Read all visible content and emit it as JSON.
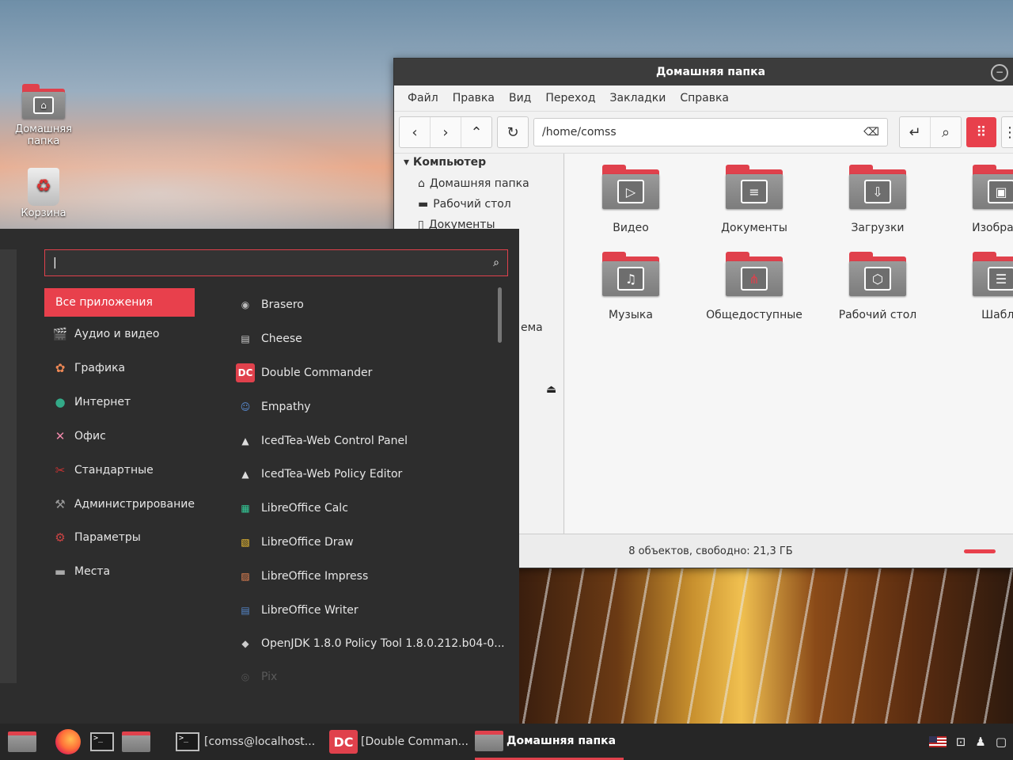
{
  "desktop": {
    "icons": [
      {
        "label": "Домашняя папка",
        "icon": "home-folder-icon"
      },
      {
        "label": "Корзина",
        "icon": "trash-icon"
      }
    ]
  },
  "file_manager": {
    "title": "Домашняя папка",
    "menu": [
      "Файл",
      "Правка",
      "Вид",
      "Переход",
      "Закладки",
      "Справка"
    ],
    "path": "/home/comss",
    "sidebar": {
      "heading": "Компьютер",
      "items": [
        "Домашняя папка",
        "Рабочий стол",
        "Документы"
      ],
      "partial_text": "ема"
    },
    "folders": [
      {
        "label": "Видео",
        "icon": "video-icon"
      },
      {
        "label": "Документы",
        "icon": "document-icon"
      },
      {
        "label": "Загрузки",
        "icon": "download-icon"
      },
      {
        "label": "Изображе",
        "icon": "image-icon"
      },
      {
        "label": "Музыка",
        "icon": "music-icon"
      },
      {
        "label": "Общедоступные",
        "icon": "share-icon"
      },
      {
        "label": "Рабочий стол",
        "icon": "desktop-icon"
      },
      {
        "label": "Шабло",
        "icon": "template-icon"
      }
    ],
    "status": "8 объектов, свободно: 21,3 ГБ"
  },
  "app_menu": {
    "search_value": "|",
    "categories": [
      {
        "label": "Все приложения",
        "active": true,
        "icon": ""
      },
      {
        "label": "Аудио и видео",
        "icon": "audio-video-icon",
        "color": "#d33"
      },
      {
        "label": "Графика",
        "icon": "graphics-icon",
        "color": "#e85"
      },
      {
        "label": "Интернет",
        "icon": "internet-icon",
        "color": "#3a8"
      },
      {
        "label": "Офис",
        "icon": "office-icon",
        "color": "#e8a"
      },
      {
        "label": "Стандартные",
        "icon": "accessories-icon",
        "color": "#c33"
      },
      {
        "label": "Администрирование",
        "icon": "admin-icon",
        "color": "#999"
      },
      {
        "label": "Параметры",
        "icon": "settings-icon",
        "color": "#c44"
      },
      {
        "label": "Места",
        "icon": "places-icon",
        "color": "#aaa"
      }
    ],
    "apps": [
      {
        "label": "Brasero",
        "icon": "brasero-icon",
        "color": "#bbb"
      },
      {
        "label": "Cheese",
        "icon": "cheese-icon",
        "color": "#ccc"
      },
      {
        "label": "Double Commander",
        "icon": "double-commander-icon",
        "color": "#e0414c"
      },
      {
        "label": "Empathy",
        "icon": "empathy-icon",
        "color": "#5a8fd8"
      },
      {
        "label": "IcedTea-Web Control Panel",
        "icon": "java-icon",
        "color": "#ddd"
      },
      {
        "label": "IcedTea-Web Policy Editor",
        "icon": "java-icon",
        "color": "#ddd"
      },
      {
        "label": "LibreOffice Calc",
        "icon": "libreoffice-calc-icon",
        "color": "#3c9"
      },
      {
        "label": "LibreOffice Draw",
        "icon": "libreoffice-draw-icon",
        "color": "#fc3"
      },
      {
        "label": "LibreOffice Impress",
        "icon": "libreoffice-impress-icon",
        "color": "#e85"
      },
      {
        "label": "LibreOffice Writer",
        "icon": "libreoffice-writer-icon",
        "color": "#58c"
      },
      {
        "label": "OpenJDK 1.8.0 Policy Tool 1.8.0.212.b04-0...",
        "icon": "openjdk-icon",
        "color": "#ccc"
      },
      {
        "label": "Pix",
        "icon": "pix-icon",
        "color": "#555"
      }
    ]
  },
  "taskbar": {
    "items": [
      {
        "label": "[comss@localhost...",
        "icon": "terminal-icon"
      },
      {
        "label": "[Double Comman...",
        "icon": "double-commander-icon"
      },
      {
        "label": "Домашняя папка",
        "icon": "folder-icon",
        "active": true
      }
    ],
    "tray": [
      "flag-us-icon",
      "network-icon",
      "user-icon",
      "window-icon"
    ]
  }
}
